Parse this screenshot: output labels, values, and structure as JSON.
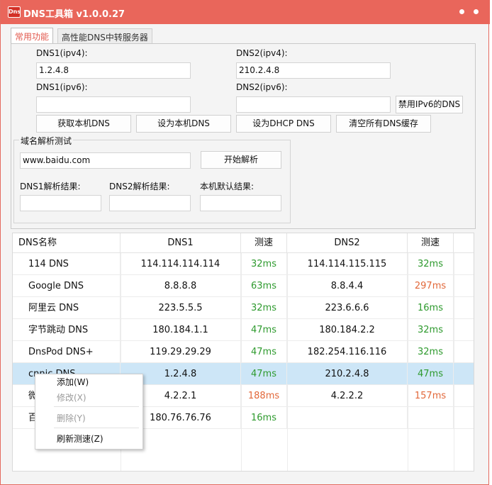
{
  "window": {
    "title": "DNS工具箱 v1.0.0.27",
    "logo_text": "Dns",
    "accent_color": "#e9665b"
  },
  "tabs": [
    {
      "label": "常用功能",
      "active": true
    },
    {
      "label": "高性能DNS中转服务器",
      "active": false
    }
  ],
  "dns_form": {
    "dns1_ipv4_label": "DNS1(ipv4):",
    "dns1_ipv4_value": "1.2.4.8",
    "dns2_ipv4_label": "DNS2(ipv4):",
    "dns2_ipv4_value": "210.2.4.8",
    "dns1_ipv6_label": "DNS1(ipv6):",
    "dns1_ipv6_value": "",
    "dns2_ipv6_label": "DNS2(ipv6):",
    "dns2_ipv6_value": "",
    "disable_ipv6_button": "禁用IPv6的DNS",
    "get_local_dns_button": "获取本机DNS",
    "set_local_dns_button": "设为本机DNS",
    "set_dhcp_dns_button": "设为DHCP DNS",
    "flush_dns_button": "清空所有DNS缓存"
  },
  "resolve_test": {
    "group_title": "域名解析测试",
    "domain_value": "www.baidu.com",
    "start_button": "开始解析",
    "dns1_result_label": "DNS1解析结果:",
    "dns2_result_label": "DNS2解析结果:",
    "local_result_label": "本机默认结果:",
    "dns1_result": "",
    "dns2_result": "",
    "local_result": ""
  },
  "table": {
    "headers": [
      "DNS名称",
      "DNS1",
      "测速",
      "DNS2",
      "测速"
    ],
    "rows": [
      {
        "name": "114 DNS",
        "dns1": "114.114.114.114",
        "speed1": "32ms",
        "speed1_color": "#2e9a2e",
        "dns2": "114.114.115.115",
        "speed2": "32ms",
        "speed2_color": "#2e9a2e"
      },
      {
        "name": "Google DNS",
        "dns1": "8.8.8.8",
        "speed1": "63ms",
        "speed1_color": "#2e9a2e",
        "dns2": "8.8.4.4",
        "speed2": "297ms",
        "speed2_color": "#e2683a"
      },
      {
        "name": "阿里云 DNS",
        "dns1": "223.5.5.5",
        "speed1": "32ms",
        "speed1_color": "#2e9a2e",
        "dns2": "223.6.6.6",
        "speed2": "16ms",
        "speed2_color": "#2e9a2e"
      },
      {
        "name": "字节跳动 DNS",
        "dns1": "180.184.1.1",
        "speed1": "47ms",
        "speed1_color": "#2e9a2e",
        "dns2": "180.184.2.2",
        "speed2": "32ms",
        "speed2_color": "#2e9a2e"
      },
      {
        "name": "DnsPod DNS+",
        "dns1": "119.29.29.29",
        "speed1": "47ms",
        "speed1_color": "#2e9a2e",
        "dns2": "182.254.116.116",
        "speed2": "32ms",
        "speed2_color": "#2e9a2e"
      },
      {
        "name": "cnnic DNS",
        "dns1": "1.2.4.8",
        "speed1": "47ms",
        "speed1_color": "#2e9a2e",
        "dns2": "210.2.4.8",
        "speed2": "47ms",
        "speed2_color": "#2e9a2e",
        "selected": true
      },
      {
        "name": "微",
        "dns1": "4.2.2.1",
        "speed1": "188ms",
        "speed1_color": "#e2683a",
        "dns2": "4.2.2.2",
        "speed2": "157ms",
        "speed2_color": "#e2683a"
      },
      {
        "name": "百",
        "dns1": "180.76.76.76",
        "speed1": "16ms",
        "speed1_color": "#2e9a2e",
        "dns2": "",
        "speed2": "",
        "speed2_color": "#2e9a2e"
      }
    ]
  },
  "context_menu": {
    "add": "添加(W)",
    "edit": "修改(X)",
    "delete": "删除(Y)",
    "refresh": "刷新测速(Z)"
  }
}
